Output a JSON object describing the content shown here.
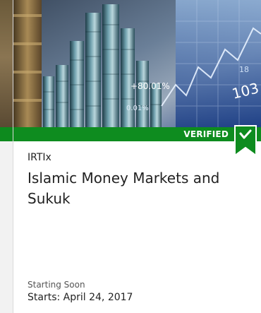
{
  "card": {
    "badge": "VERIFIED",
    "org": "IRTIx",
    "title": "Islamic Money Markets and Sukuk",
    "status": "Starting Soon",
    "start_date": "Starts: April 24, 2017"
  },
  "hero": {
    "ticker_1": "+80.01%",
    "ticker_2": "0.01%",
    "ticker_3": "103",
    "ticker_4": "18"
  },
  "colors": {
    "verified_green": "#0e8c1f",
    "text_dark": "#222222",
    "text_muted": "#555555"
  },
  "icons": {
    "verified": "bookmark-check-icon"
  }
}
